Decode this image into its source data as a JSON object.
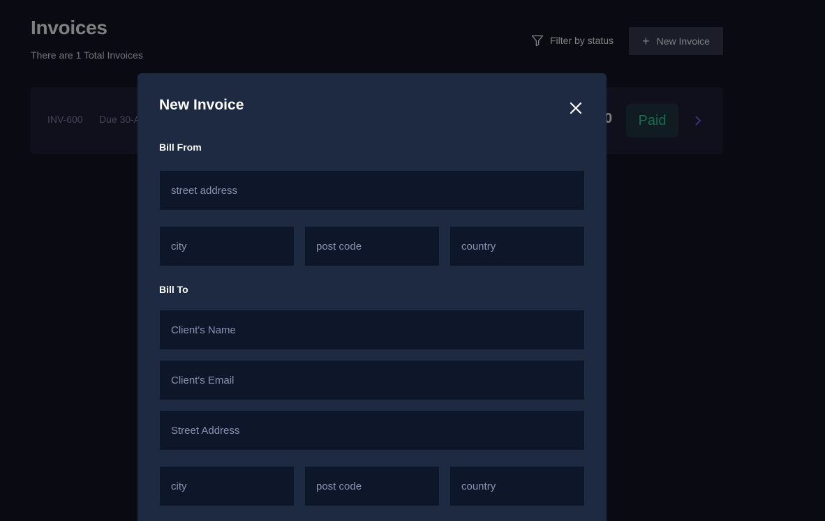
{
  "header": {
    "title": "Invoices",
    "subtitle": "There are 1 Total Invoices",
    "filter_label": "Filter by status",
    "new_invoice_label": "New Invoice"
  },
  "invoice_card": {
    "id": "INV-600",
    "due": "Due 30-A",
    "amount_tail": "0",
    "status": "Paid"
  },
  "modal": {
    "title": "New Invoice",
    "bill_from": {
      "heading": "Bill From",
      "street_placeholder": "street address",
      "city_placeholder": "city",
      "postcode_placeholder": "post code",
      "country_placeholder": "country"
    },
    "bill_to": {
      "heading": "Bill To",
      "client_name_placeholder": "Client's Name",
      "client_email_placeholder": "Client's Email",
      "street_placeholder": "Street Address",
      "city_placeholder": "city",
      "postcode_placeholder": "post code",
      "country_placeholder": "country"
    }
  },
  "icons": {
    "filter": "filter-icon",
    "plus": "plus-icon",
    "chevron": "chevron-right-icon",
    "close": "close-icon"
  },
  "colors": {
    "background": "#141625",
    "modal": "#1e2a41",
    "field": "#0e172a",
    "button": "#373b53",
    "paid": "#33d69f",
    "accent": "#7c5dfa"
  }
}
